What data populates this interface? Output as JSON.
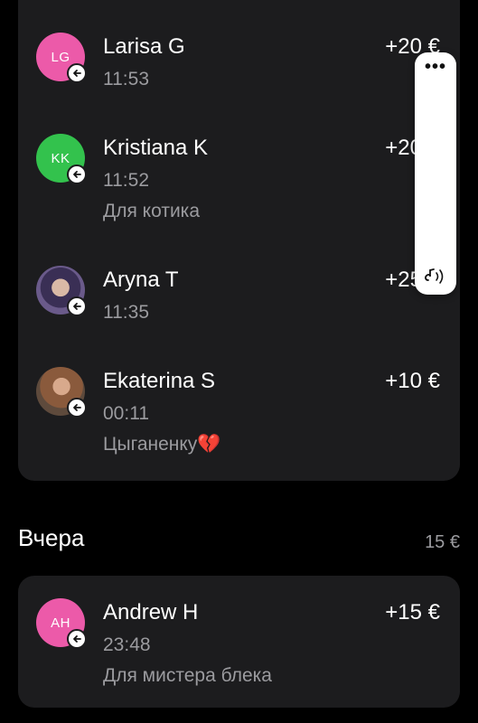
{
  "colors": {
    "background": "#000000",
    "card": "#1c1c1e",
    "primary_text": "#ffffff",
    "secondary_text": "#9b9b9f",
    "avatar_pink": "#ec5aa9",
    "avatar_green": "#33c24d"
  },
  "transactions_today": [
    {
      "initials": "LG",
      "avatar_color": "#ec5aa9",
      "avatar_type": "initials",
      "name": "Larisa G",
      "time": "11:53",
      "comment": "",
      "amount": "+20 €"
    },
    {
      "initials": "KK",
      "avatar_color": "#33c24d",
      "avatar_type": "initials",
      "name": "Kristiana K",
      "time": "11:52",
      "comment": "Для котика",
      "amount": "+20 €"
    },
    {
      "initials": "",
      "avatar_type": "photo",
      "name": "Aryna T",
      "time": "11:35",
      "comment": "",
      "amount": "+25 €"
    },
    {
      "initials": "",
      "avatar_type": "photo",
      "name": "Ekaterina S",
      "time": "00:11",
      "comment": "Цыганенку💔",
      "amount": "+10 €"
    }
  ],
  "section_yesterday": {
    "title": "Вчера",
    "total": "15 €"
  },
  "transactions_yesterday": [
    {
      "initials": "AH",
      "avatar_color": "#ec5aa9",
      "avatar_type": "initials",
      "name": "Andrew H",
      "time": "23:48",
      "comment": "Для мистера блека",
      "amount": "+15 €"
    }
  ],
  "overlay": {
    "menu_glyph": "•••",
    "icon": "sound-wave-icon"
  }
}
